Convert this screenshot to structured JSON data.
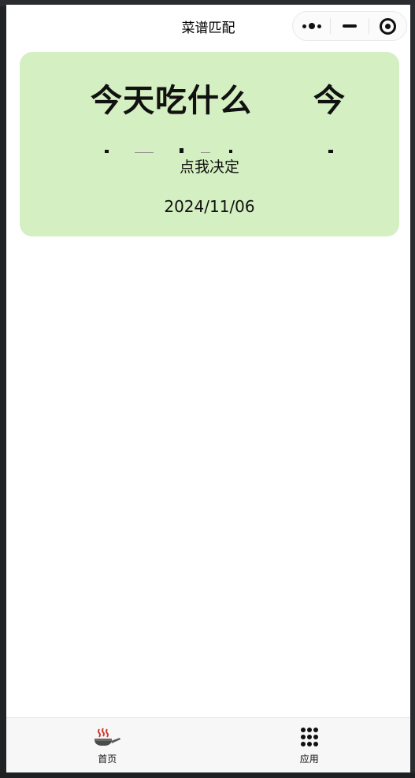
{
  "navbar": {
    "title": "菜谱匹配",
    "more_icon": "more-dots-icon",
    "minimize_icon": "minimize-icon",
    "close_icon": "target-circle-icon"
  },
  "banner": {
    "title_text": "今天吃什么",
    "title_repeat": "今",
    "decide_label": "点我决定",
    "date": "2024/11/06",
    "background_color": "#d4efc1"
  },
  "tabbar": {
    "items": [
      {
        "label": "首页",
        "icon": "frying-pan-icon"
      },
      {
        "label": "应用",
        "icon": "apps-grid-icon"
      }
    ]
  }
}
